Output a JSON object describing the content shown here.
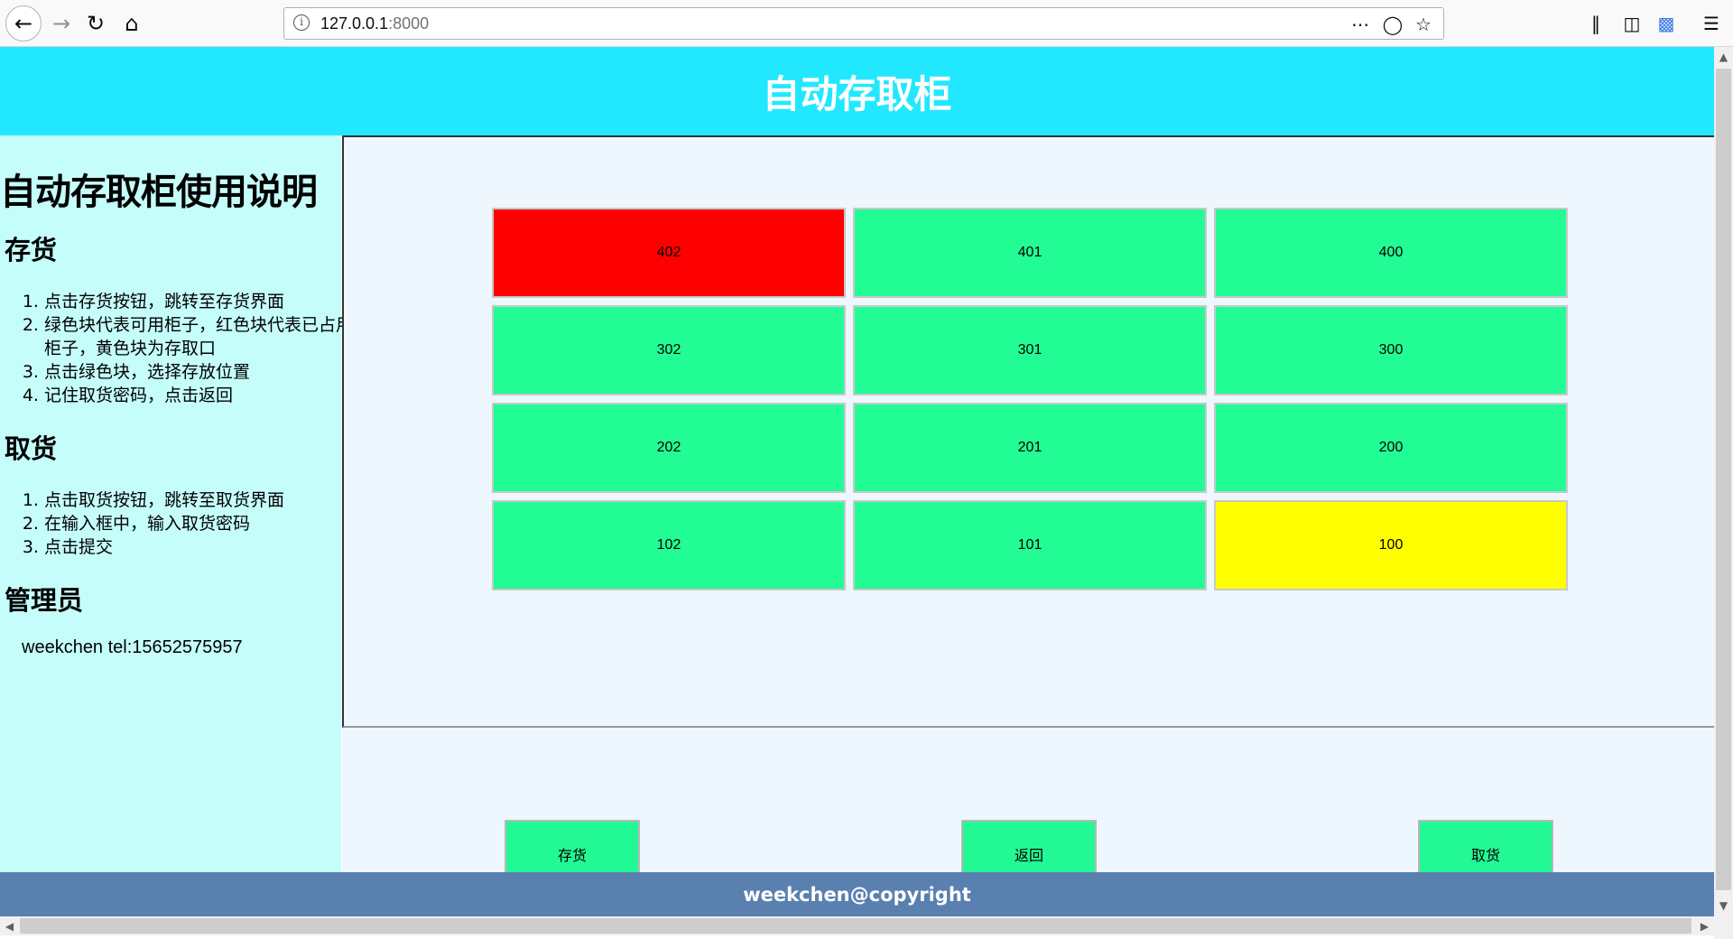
{
  "browser": {
    "url_host": "127.0.0.1",
    "url_port": ":8000"
  },
  "header": {
    "title": "自动存取柜"
  },
  "sidebar": {
    "title": "自动存取柜使用说明",
    "store_heading": "存货",
    "store_steps": [
      "点击存货按钮，跳转至存货界面",
      "绿色块代表可用柜子，红色块代表已占用柜子，黄色块为存取口",
      "点击绿色块，选择存放位置",
      "记住取货密码，点击返回"
    ],
    "retrieve_heading": "取货",
    "retrieve_steps": [
      "点击取货按钮，跳转至取货界面",
      "在输入框中，输入取货密码",
      "点击提交"
    ],
    "admin_heading": "管理员",
    "admin_contact": "weekchen tel:15652575957"
  },
  "lockers": [
    {
      "id": "402",
      "status": "occupied",
      "color": "#ff0000"
    },
    {
      "id": "401",
      "status": "available",
      "color": "#22fc94"
    },
    {
      "id": "400",
      "status": "available",
      "color": "#22fc94"
    },
    {
      "id": "302",
      "status": "available",
      "color": "#22fc94"
    },
    {
      "id": "301",
      "status": "available",
      "color": "#22fc94"
    },
    {
      "id": "300",
      "status": "available",
      "color": "#22fc94"
    },
    {
      "id": "202",
      "status": "available",
      "color": "#22fc94"
    },
    {
      "id": "201",
      "status": "available",
      "color": "#22fc94"
    },
    {
      "id": "200",
      "status": "available",
      "color": "#22fc94"
    },
    {
      "id": "102",
      "status": "available",
      "color": "#22fc94"
    },
    {
      "id": "101",
      "status": "available",
      "color": "#22fc94"
    },
    {
      "id": "100",
      "status": "access-port",
      "color": "#ffff00"
    }
  ],
  "actions": {
    "store_label": "存货",
    "back_label": "返回",
    "retrieve_label": "取货"
  },
  "footer": {
    "text": "weekchen@copyright"
  }
}
